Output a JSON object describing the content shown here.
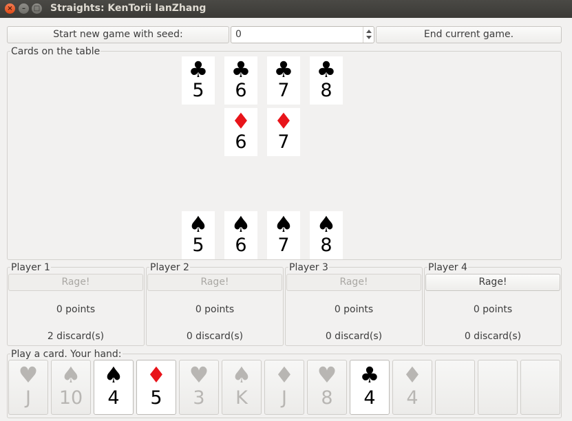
{
  "window": {
    "title": "Straights: KenTorii IanZhang",
    "close_glyph": "×",
    "min_glyph": "–",
    "max_glyph": "□"
  },
  "toolbar": {
    "new_game_label": "Start new game with seed:",
    "seed_value": "0",
    "end_game_label": "End current game."
  },
  "table": {
    "label": "Cards on the table",
    "clubs": [
      {
        "suit": "♣",
        "rank": "5"
      },
      {
        "suit": "♣",
        "rank": "6"
      },
      {
        "suit": "♣",
        "rank": "7"
      },
      {
        "suit": "♣",
        "rank": "8"
      }
    ],
    "diamonds": [
      {
        "suit": "♦",
        "rank": "6"
      },
      {
        "suit": "♦",
        "rank": "7"
      }
    ],
    "spades": [
      {
        "suit": "♠",
        "rank": "5"
      },
      {
        "suit": "♠",
        "rank": "6"
      },
      {
        "suit": "♠",
        "rank": "7"
      },
      {
        "suit": "♠",
        "rank": "8"
      }
    ]
  },
  "players": [
    {
      "label": "Player 1",
      "rage": "Rage!",
      "points": "0 points",
      "discards": "2 discard(s)"
    },
    {
      "label": "Player 2",
      "rage": "Rage!",
      "points": "0 points",
      "discards": "0 discard(s)"
    },
    {
      "label": "Player 3",
      "rage": "Rage!",
      "points": "0 points",
      "discards": "0 discard(s)"
    },
    {
      "label": "Player 4",
      "rage": "Rage!",
      "points": "0 points",
      "discards": "0 discard(s)"
    }
  ],
  "hand": {
    "label": "Play a card. Your hand:",
    "cards": [
      {
        "suit": "♥",
        "rank": "J"
      },
      {
        "suit": "♠",
        "rank": "10"
      },
      {
        "suit": "♠",
        "rank": "4"
      },
      {
        "suit": "♦",
        "rank": "5"
      },
      {
        "suit": "♥",
        "rank": "3"
      },
      {
        "suit": "♠",
        "rank": "K"
      },
      {
        "suit": "♦",
        "rank": "J"
      },
      {
        "suit": "♥",
        "rank": "8"
      },
      {
        "suit": "♣",
        "rank": "4"
      },
      {
        "suit": "♦",
        "rank": "4"
      }
    ]
  },
  "colors": {
    "red_suit": "#e8141a",
    "black_suit": "#000000",
    "dim_card": "#b8b6b3",
    "titlebar": "#3c3b37"
  }
}
